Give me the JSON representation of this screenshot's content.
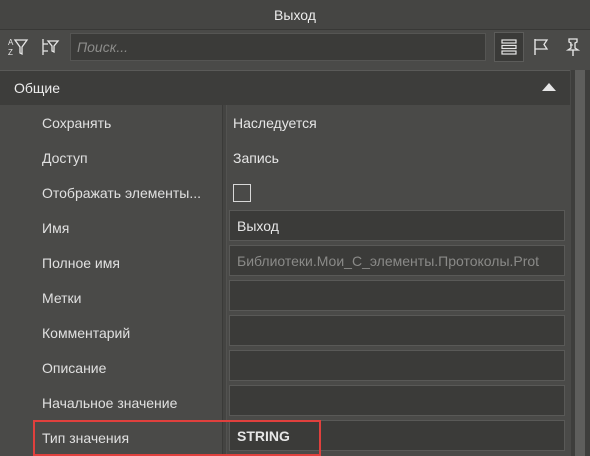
{
  "window": {
    "title": "Выход"
  },
  "toolbar": {
    "search_placeholder": "Поиск...",
    "icons": [
      "sort-az-filter-icon",
      "tree-filter-icon",
      "list-view-icon",
      "flag-icon",
      "pin-icon"
    ]
  },
  "section": {
    "title": "Общие",
    "expanded": true
  },
  "properties": [
    {
      "label": "Сохранять",
      "value": "Наследуется",
      "kind": "text"
    },
    {
      "label": "Доступ",
      "value": "Запись",
      "kind": "text"
    },
    {
      "label": "Отображать элементы...",
      "value": "",
      "kind": "checkbox",
      "checked": false
    },
    {
      "label": "Имя",
      "value": "Выход",
      "kind": "field"
    },
    {
      "label": "Полное имя",
      "value": "Библиотеки.Мои_С_элементы.Протоколы.Prot",
      "kind": "field-disabled"
    },
    {
      "label": "Метки",
      "value": "",
      "kind": "field"
    },
    {
      "label": "Комментарий",
      "value": "",
      "kind": "field"
    },
    {
      "label": "Описание",
      "value": "",
      "kind": "field"
    },
    {
      "label": "Начальное значение",
      "value": "",
      "kind": "field"
    },
    {
      "label": "Тип значения",
      "value": "STRING",
      "kind": "field-bold"
    }
  ],
  "colors": {
    "highlight": "#e0403d",
    "background": "#4a4a48"
  }
}
